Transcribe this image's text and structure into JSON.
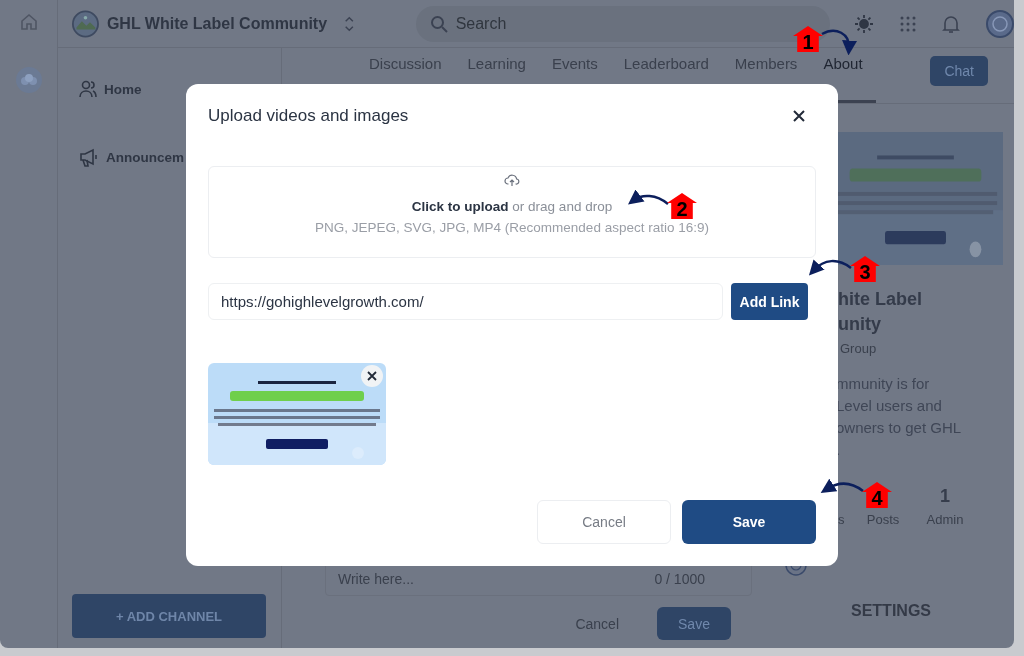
{
  "header": {
    "community": "GHL White Label Community",
    "search": {
      "placeholder": "Search"
    }
  },
  "sidebar": {
    "items": [
      {
        "label": "Home",
        "kind": "home"
      },
      {
        "label": "Announcem",
        "kind": "announcement"
      }
    ],
    "add_channel": "+ ADD CHANNEL"
  },
  "tabs": [
    {
      "label": "Discussion",
      "selected": false
    },
    {
      "label": "Learning",
      "selected": false
    },
    {
      "label": "Events",
      "selected": false
    },
    {
      "label": "Leaderboard",
      "selected": false
    },
    {
      "label": "Members",
      "selected": false
    },
    {
      "label": "About",
      "selected": true
    }
  ],
  "chat_button": "Chat",
  "about": {
    "banner": {
      "kind": "picture"
    },
    "title_lines": [
      "hite Label",
      "unity"
    ],
    "subtitle": "Group",
    "description_lines": [
      "mmunity is for",
      "Level users and",
      "owners to get GHL",
      "."
    ],
    "stats": [
      {
        "label": "s"
      },
      {
        "label": "Posts"
      },
      {
        "value": "1",
        "label": "Admin"
      }
    ],
    "settings": "SETTINGS"
  },
  "composer": {
    "placeholder": "Write here...",
    "counter": "0 / 1000",
    "cancel": "Cancel",
    "save": "Save"
  },
  "modal": {
    "title": "Upload videos and images",
    "dropzone": {
      "line": "**Click to upload** or drag and drop",
      "hint": "PNG, JEPEG, SVG, JPG, MP4 (Recommended aspect ratio 16:9)"
    },
    "link_field": {
      "value": "https://gohighlevelgrowth.com/"
    },
    "add_link": "Add Link",
    "attachments": [
      {
        "kind": "picture"
      }
    ],
    "cancel": "Cancel",
    "save": "Save"
  },
  "annotations": [
    {
      "label": "1"
    },
    {
      "label": "2"
    },
    {
      "label": "3"
    },
    {
      "label": "4"
    }
  ]
}
